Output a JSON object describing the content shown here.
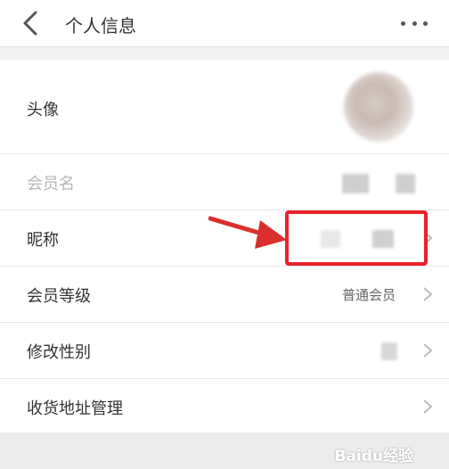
{
  "header": {
    "title": "个人信息"
  },
  "rows": [
    {
      "label": "头像"
    },
    {
      "label": "会员名"
    },
    {
      "label": "昵称"
    },
    {
      "label": "会员等级",
      "value": "普通会员"
    },
    {
      "label": "修改性别"
    },
    {
      "label": "收货地址管理"
    }
  ],
  "watermark": "Baidu经验",
  "colors": {
    "highlight": "#e8232b",
    "arrow": "#d9302b",
    "header_bg": "#ffffff",
    "page_bg": "#f0f0f0"
  },
  "icons": [
    "back-arrow-icon",
    "more-dots-icon",
    "chevron-right-icon"
  ]
}
